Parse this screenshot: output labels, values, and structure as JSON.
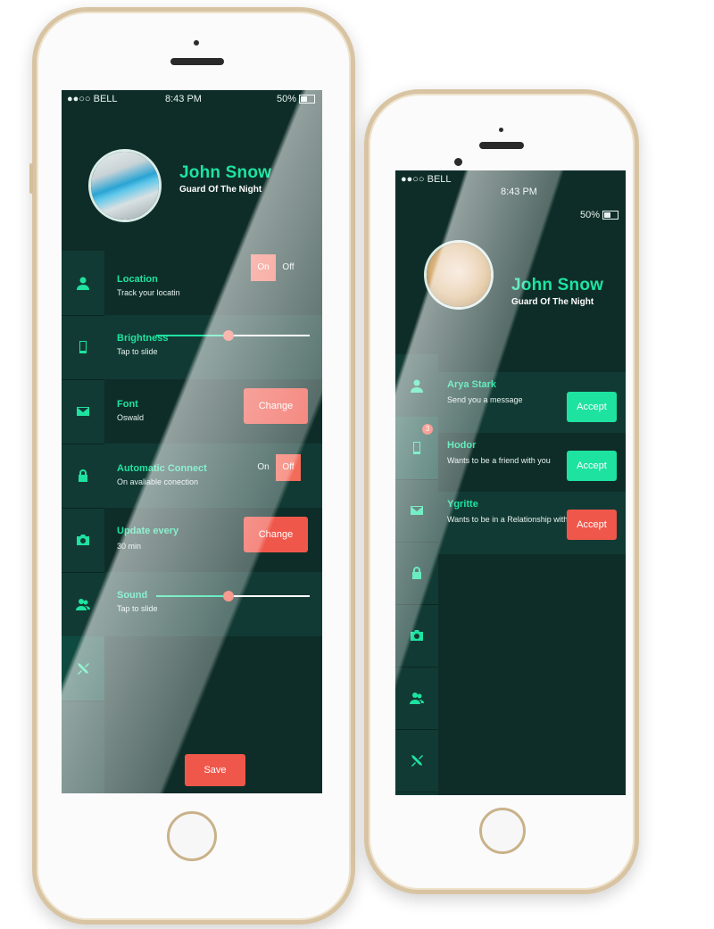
{
  "colors": {
    "screen_bg": "#0e2d28",
    "accent_green": "#1ee3a0",
    "accent_red": "#f0574b",
    "phone_frame": "#d8c4a2"
  },
  "left_phone": {
    "status": {
      "carrier": "●●○○ BELL",
      "time": "8:43 PM",
      "battery": "50%"
    },
    "profile": {
      "name": "John Snow",
      "subtitle": "Guard Of The Night"
    },
    "sidebar_icons": [
      "user-icon",
      "mobile-icon",
      "mail-icon",
      "lock-icon",
      "camera-icon",
      "users-icon",
      "tools-icon"
    ],
    "settings": {
      "location": {
        "title": "Location",
        "subtitle": "Track your locatin",
        "on_label": "On",
        "off_label": "Off",
        "selected": "On"
      },
      "brightness": {
        "title": "Brightness",
        "subtitle": "Tap to slide",
        "level": 0.47
      },
      "font": {
        "title": "Font",
        "subtitle": "Oswald",
        "button": "Change"
      },
      "automatic_connect": {
        "title": "Automatic Connect",
        "subtitle": "On avaliable conection",
        "on_label": "On",
        "off_label": "Off",
        "selected": "Off"
      },
      "update_every": {
        "title": "Update every",
        "subtitle": "30 min",
        "button": "Change"
      },
      "sound": {
        "title": "Sound",
        "subtitle": "Tap to slide",
        "level": 0.47
      }
    },
    "save_button": "Save"
  },
  "right_phone": {
    "status": {
      "carrier": "●●○○ BELL",
      "time": "8:43 PM",
      "battery": "50%"
    },
    "profile": {
      "name": "John Snow",
      "subtitle": "Guard Of The Night"
    },
    "sidebar_icons": [
      "user-icon",
      "mobile-icon",
      "mail-icon",
      "lock-icon",
      "camera-icon",
      "users-icon",
      "tools-icon"
    ],
    "badge_count": "3",
    "requests": [
      {
        "name": "Arya Stark",
        "message": "Send you a message",
        "button": "Accept",
        "button_color": "green"
      },
      {
        "name": "Hodor",
        "message": "Wants to be a friend with you",
        "button": "Accept",
        "button_color": "green"
      },
      {
        "name": "Ygritte",
        "message": "Wants to be in a Relationship with you",
        "button": "Accept",
        "button_color": "red"
      }
    ]
  }
}
